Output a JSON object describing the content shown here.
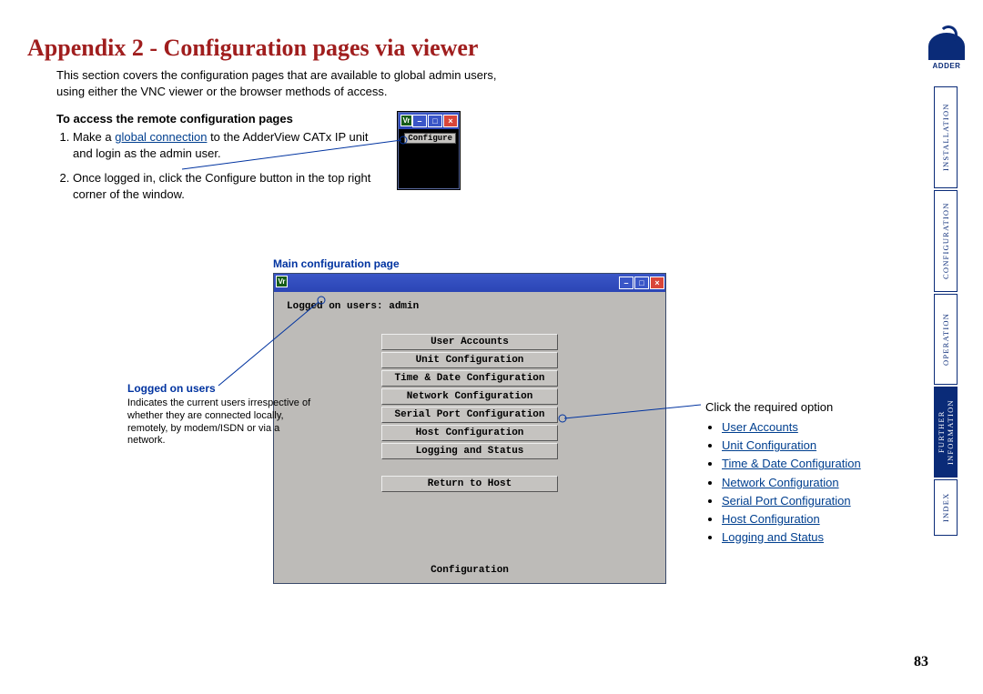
{
  "title": "Appendix 2 - Configuration pages via viewer",
  "intro": "This section covers the configuration pages that are available to global admin users, using either the VNC viewer or the browser methods of access.",
  "subhead": "To access the remote configuration pages",
  "step1_a": "Make a ",
  "step1_link": "global connection",
  "step1_b": " to the AdderView CATx IP unit and login as the admin user.",
  "step2": "Once logged in, click the Configure button in the top right corner of the window.",
  "caption_main": "Main configuration page",
  "callout_users": {
    "title": "Logged on users",
    "body": "Indicates the current users irrespective of whether they are connected locally, remotely, by modem/ISDN or via a network."
  },
  "callout_right_lead": "Click the required option",
  "callout_right_items": [
    "User Accounts",
    "Unit Configuration",
    "Time & Date Configuration",
    "Network Configuration",
    "Serial Port Configuration",
    "Host Configuration",
    "Logging and Status"
  ],
  "win_small": {
    "vr": "Vr",
    "configure": "Configure"
  },
  "win_large": {
    "logged": "Logged on users: admin",
    "buttons": [
      "User Accounts",
      "Unit Configuration",
      "Time & Date Configuration",
      "Network Configuration",
      "Serial Port Configuration",
      "Host Configuration",
      "Logging and Status"
    ],
    "return_btn": "Return to Host",
    "panel_title": "Configuration"
  },
  "sidetabs": [
    "INSTALLATION",
    "CONFIGURATION",
    "OPERATION",
    "FURTHER INFORMATION",
    "INDEX"
  ],
  "logo_text": "ADDER",
  "pagenum": "83"
}
